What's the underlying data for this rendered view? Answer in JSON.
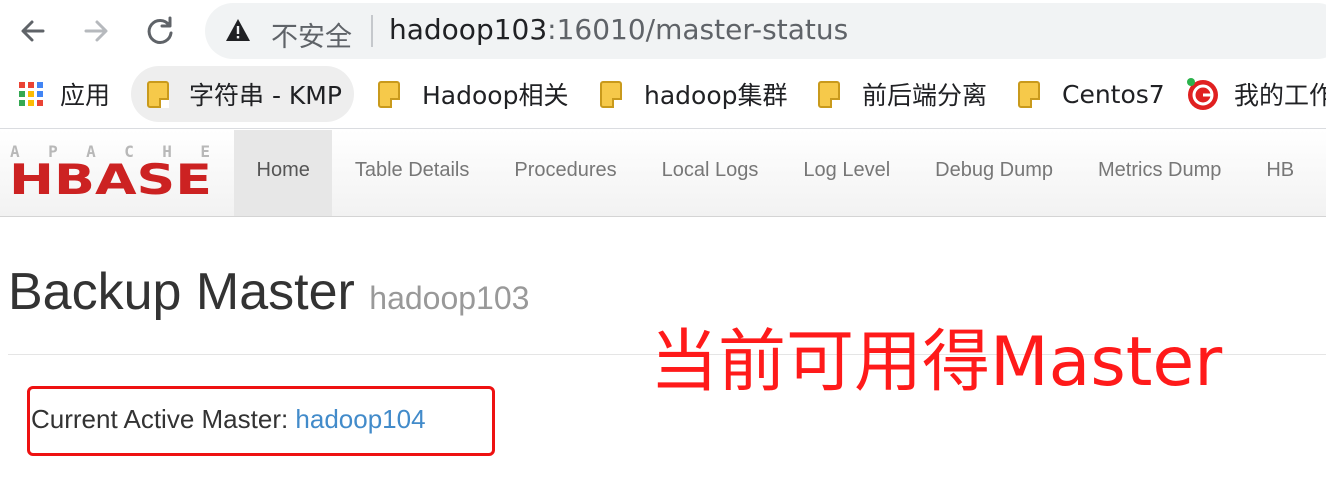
{
  "browser": {
    "security_text": "不安全",
    "url_host": "hadoop103",
    "url_path": ":16010/master-status",
    "icons": [
      "back-arrow-icon",
      "forward-arrow-icon",
      "reload-icon",
      "warning-icon"
    ]
  },
  "bookmarks": {
    "apps_label": "应用",
    "items": [
      {
        "label": "字符串 - KMP",
        "icon": "folder-icon"
      },
      {
        "label": "Hadoop相关",
        "icon": "folder-icon"
      },
      {
        "label": "hadoop集群",
        "icon": "folder-icon"
      },
      {
        "label": "前后端分离",
        "icon": "folder-icon"
      },
      {
        "label": "Centos7",
        "icon": "folder-icon"
      },
      {
        "label": "我的工作",
        "icon": "site-icon"
      }
    ]
  },
  "hbase": {
    "logo_top": "APACHE",
    "logo_main": "HBASE",
    "nav": [
      "Home",
      "Table Details",
      "Procedures",
      "Local Logs",
      "Log Level",
      "Debug Dump",
      "Metrics Dump",
      "HB"
    ]
  },
  "page": {
    "title": "Backup Master",
    "subtitle": "hadoop103",
    "current_master_label": "Current Active Master: ",
    "current_master_value": "hadoop104"
  },
  "annotation": {
    "text": "当前可用得Master",
    "color": "#ff1a1a"
  },
  "colors": {
    "link": "#428bca",
    "logo_red": "#cc2222",
    "highlight": "#ee1111"
  }
}
